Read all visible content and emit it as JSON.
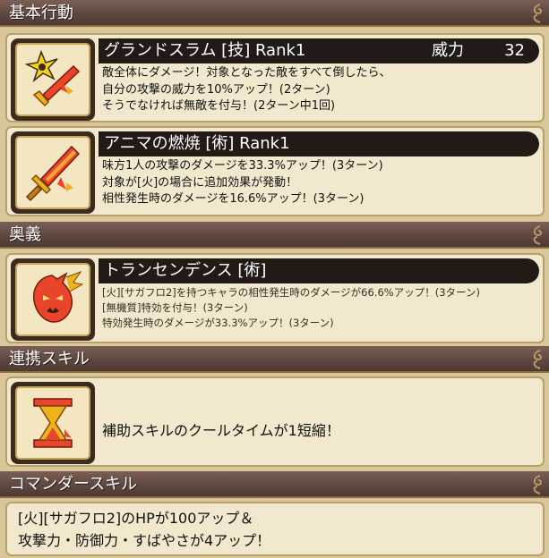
{
  "sections": {
    "basic": "基本行動",
    "ougi": "奥義",
    "renkei": "連携スキル",
    "commander": "コマンダースキル"
  },
  "skills": [
    {
      "icon": "shuriken-sword-icon",
      "title": "グランドスラム [技]  Rank1",
      "power_label": "威力",
      "power_value": "32",
      "lines": [
        "敵全体にダメージ！対象となった敵をすべて倒したら、",
        "自分の攻撃の威力を10%アップ！(2ターン)",
        "そうでなければ無敵を付与！(2ターン中1回)"
      ]
    },
    {
      "icon": "flame-sword-icon",
      "title": "アニマの燃焼 [術]  Rank1",
      "lines": [
        "味方1人の攻撃のダメージを33.3%アップ！(3ターン)",
        "対象が[火]の場合に追加効果が発動！",
        "相性発生時のダメージを16.6%アップ！(3ターン)"
      ]
    }
  ],
  "ougi_skill": {
    "icon": "flame-demon-icon",
    "title": "トランセンデンス [術]",
    "lines": [
      "[火][サガフロ2]を持つキャラの相性発生時のダメージが66.6%アップ！(3ターン)",
      "[無機質]特効を付与！(3ターン)",
      "特効発生時のダメージが33.3%アップ！(3ターン)"
    ]
  },
  "renkei_skill": {
    "icon": "hourglass-icon",
    "text": "補助スキルのクールタイムが1短縮！"
  },
  "commander_skill": {
    "lines": [
      "[火][サガフロ2]のHPが100アップ＆",
      "攻撃力・防御力・すばやさが4アップ！"
    ]
  },
  "colors": {
    "header": "#5f4740",
    "card": "#f1e8cd",
    "titlebar": "#221a16",
    "icon_red": "#d8381f",
    "icon_gold": "#f0b21c"
  }
}
